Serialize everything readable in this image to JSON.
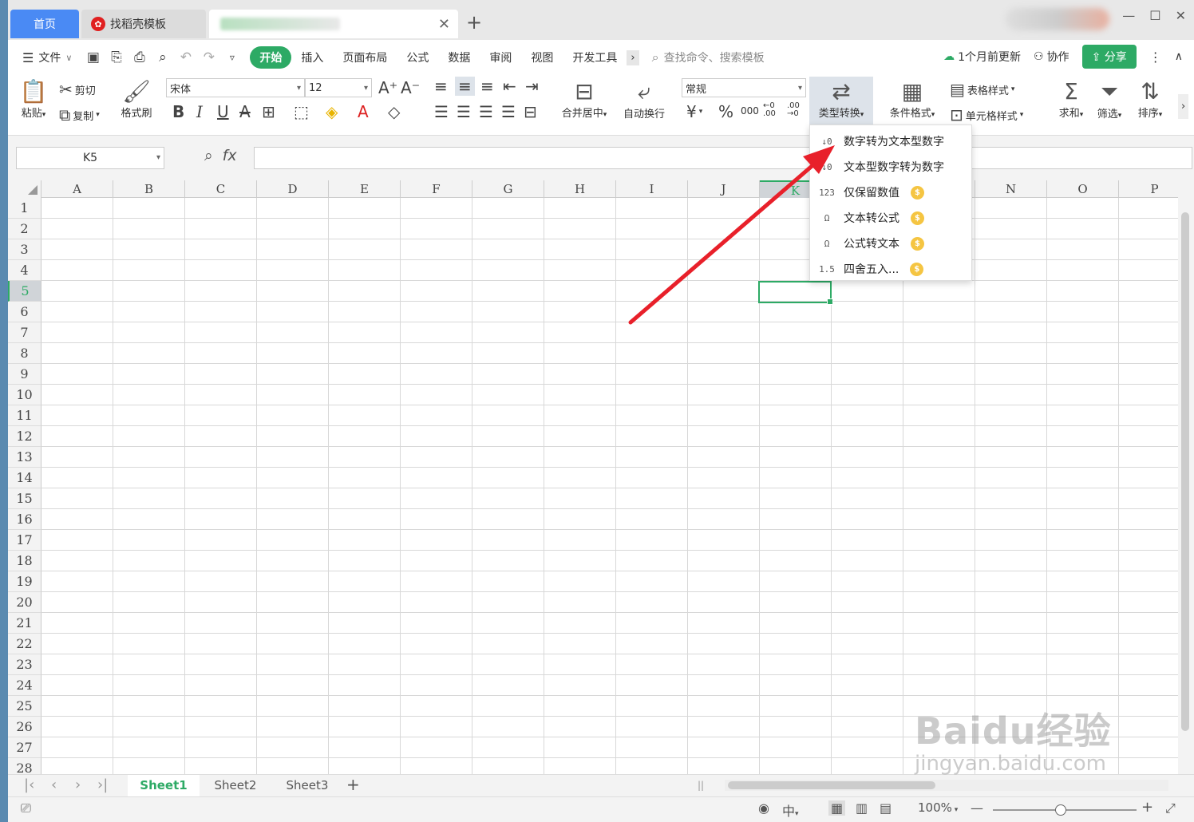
{
  "tabs": {
    "home": "首页",
    "template": "找稻壳模板"
  },
  "menu": {
    "file": "文件",
    "items": [
      "开始",
      "插入",
      "页面布局",
      "公式",
      "数据",
      "审阅",
      "视图",
      "开发工具"
    ],
    "search_placeholder": "查找命令、搜索模板",
    "update": "1个月前更新",
    "collab": "协作",
    "share": "分享"
  },
  "ribbon": {
    "paste": "粘贴",
    "cut": "剪切",
    "copy": "复制",
    "format_painter": "格式刷",
    "font_name": "宋体",
    "font_size": "12",
    "merge": "合并居中",
    "wrap": "自动换行",
    "number_format": "常规",
    "currency": "¥",
    "percent": "%",
    "thousands": "000",
    "type_convert": "类型转换",
    "cond_format": "条件格式",
    "table_style": "表格样式",
    "cell_style": "单元格样式",
    "sum": "求和",
    "filter": "筛选",
    "sort": "排序"
  },
  "formula_bar": {
    "name_box": "K5",
    "fx": "fx"
  },
  "columns": [
    "A",
    "B",
    "C",
    "D",
    "E",
    "F",
    "G",
    "H",
    "I",
    "J",
    "K",
    "L",
    "M",
    "N",
    "O",
    "P"
  ],
  "rows": [
    "1",
    "2",
    "3",
    "4",
    "5",
    "6",
    "7",
    "8",
    "9",
    "10",
    "11",
    "12",
    "13",
    "14",
    "15",
    "16",
    "17",
    "18",
    "19",
    "20",
    "21",
    "22",
    "23",
    "24",
    "25",
    "26",
    "27",
    "28"
  ],
  "dropdown": [
    {
      "icon": "num-to-text-icon",
      "glyph": "↓0",
      "label": "数字转为文本型数字",
      "vip": false
    },
    {
      "icon": "text-to-num-icon",
      "glyph": "↓0",
      "label": "文本型数字转为数字",
      "vip": false
    },
    {
      "icon": "keep-values-icon",
      "glyph": "123",
      "label": "仅保留数值",
      "vip": true
    },
    {
      "icon": "text-to-formula-icon",
      "glyph": "Ω",
      "label": "文本转公式",
      "vip": true
    },
    {
      "icon": "formula-to-text-icon",
      "glyph": "Ω",
      "label": "公式转文本",
      "vip": true
    },
    {
      "icon": "round-icon",
      "glyph": "1.5",
      "label": "四舍五入...",
      "vip": true
    }
  ],
  "vip_glyph": "$",
  "sheets": [
    "Sheet1",
    "Sheet2",
    "Sheet3"
  ],
  "status": {
    "zoom": "100%",
    "ime": "中"
  },
  "watermark": {
    "big": "Baidu经验",
    "small": "jingyan.baidu.com"
  },
  "colors": {
    "accent": "#2daa65",
    "home_tab": "#4a8af4",
    "arrow": "#e8202a"
  }
}
